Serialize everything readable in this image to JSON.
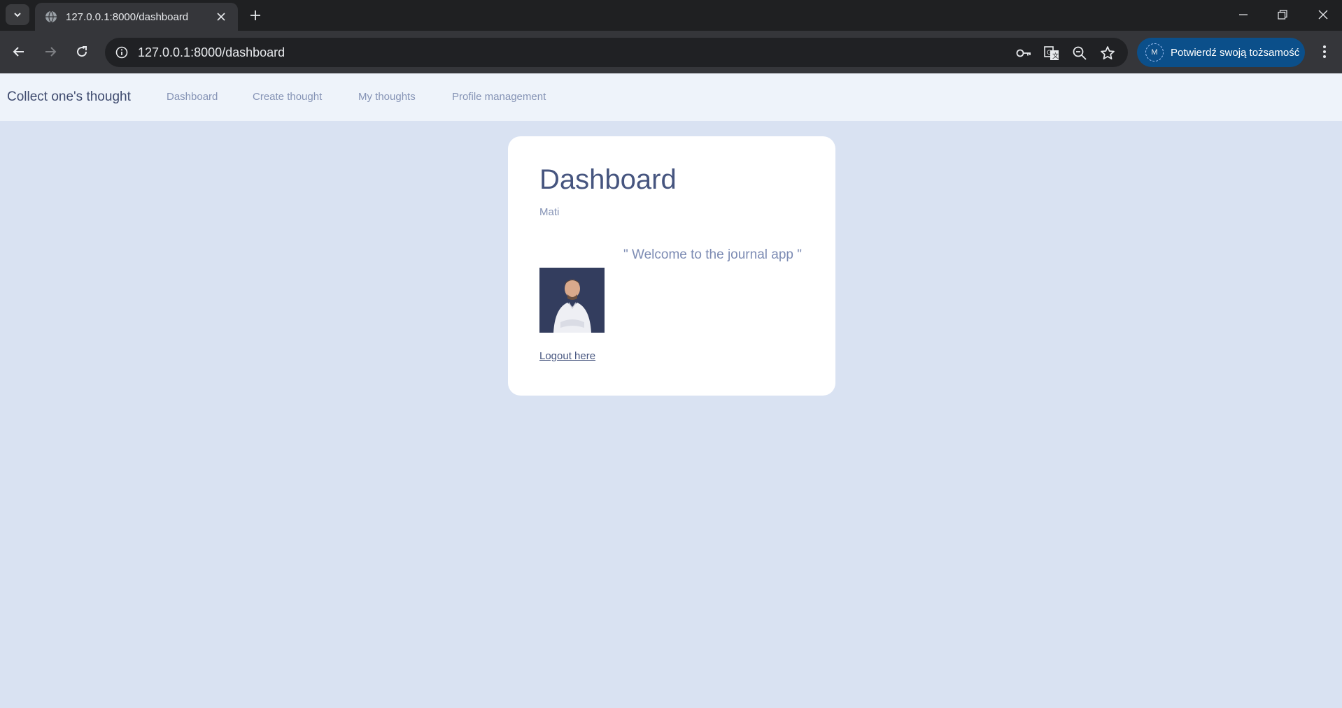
{
  "browser": {
    "tab_title": "127.0.0.1:8000/dashboard",
    "url": "127.0.0.1:8000/dashboard",
    "profile_label": "Potwierdź swoją tożsamość",
    "profile_initial": "M"
  },
  "navbar": {
    "brand": "Collect one's thought",
    "links": [
      "Dashboard",
      "Create thought",
      "My thoughts",
      "Profile management"
    ]
  },
  "card": {
    "title": "Dashboard",
    "username": "Mati",
    "welcome": "\" Welcome to the journal app \"",
    "logout": "Logout here"
  },
  "colors": {
    "page_bg": "#d9e2f2",
    "navbar_bg": "#eef3fa",
    "accent_text": "#46557f",
    "muted_text": "#8593b5",
    "profile_btn": "#0b4f8a"
  }
}
